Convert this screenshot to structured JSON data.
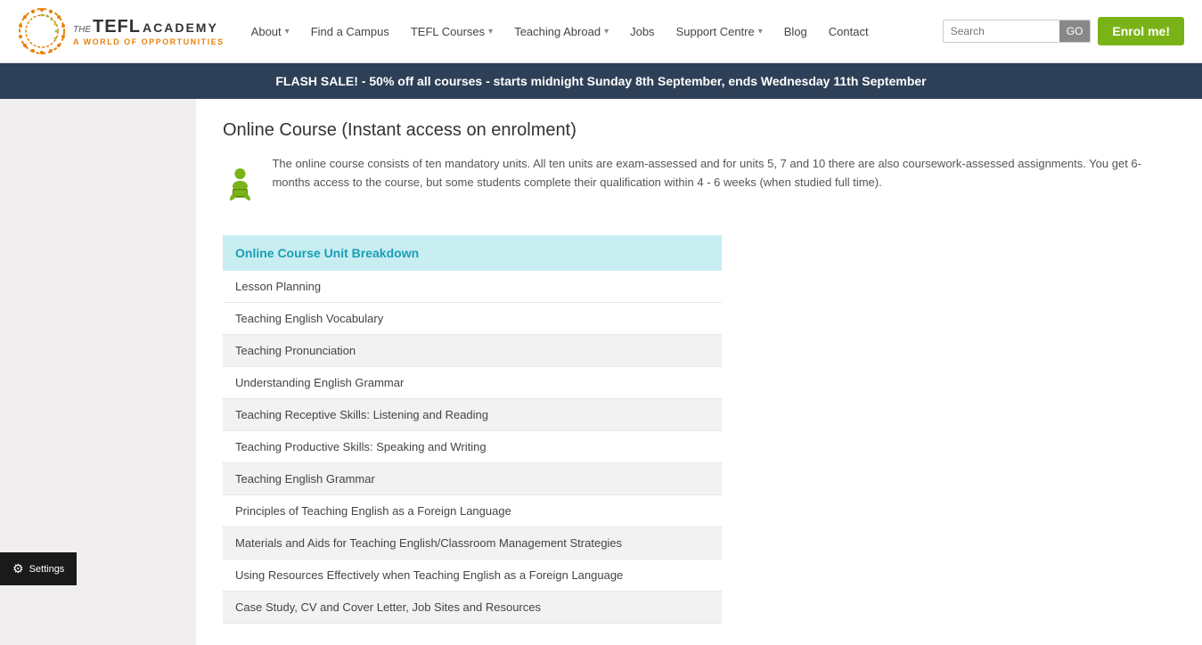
{
  "header": {
    "logo": {
      "brand_line": "THE TEFL ACADEMY",
      "tagline": "A WORLD OF OPPORTUNITIES"
    },
    "nav": [
      {
        "label": "About",
        "has_dropdown": true
      },
      {
        "label": "Find a Campus",
        "has_dropdown": false
      },
      {
        "label": "TEFL Courses",
        "has_dropdown": true
      },
      {
        "label": "Teaching Abroad",
        "has_dropdown": true
      },
      {
        "label": "Jobs",
        "has_dropdown": false
      },
      {
        "label": "Support Centre",
        "has_dropdown": true
      },
      {
        "label": "Blog",
        "has_dropdown": false
      },
      {
        "label": "Contact",
        "has_dropdown": false
      }
    ],
    "search": {
      "placeholder": "Search",
      "go_label": "GO"
    },
    "enrol_label": "Enrol me!"
  },
  "flash_banner": {
    "text": "FLASH SALE! - 50% off all courses - starts midnight Sunday 8th September, ends Wednesday 11th September"
  },
  "main": {
    "page_title": "Online Course (Instant access on enrolment)",
    "intro_text": "The online course consists of ten mandatory units. All ten units are exam-assessed and for units 5, 7 and 10 there are also coursework-assessed assignments. You get 6-months access to the course, but some students complete their qualification within 4 - 6 weeks (when studied full time).",
    "breakdown": {
      "header": "Online Course Unit Breakdown",
      "units": [
        {
          "label": "Lesson Planning",
          "shaded": false
        },
        {
          "label": "Teaching English Vocabulary",
          "shaded": false
        },
        {
          "label": "Teaching Pronunciation",
          "shaded": true
        },
        {
          "label": "Understanding English Grammar",
          "shaded": false
        },
        {
          "label": "Teaching Receptive Skills: Listening and Reading",
          "shaded": true
        },
        {
          "label": "Teaching Productive Skills: Speaking and Writing",
          "shaded": false
        },
        {
          "label": "Teaching English Grammar",
          "shaded": true
        },
        {
          "label": "Principles of Teaching English as a Foreign Language",
          "shaded": false
        },
        {
          "label": "Materials and Aids for Teaching English/Classroom Management Strategies",
          "shaded": true
        },
        {
          "label": "Using Resources Effectively when Teaching English as a Foreign Language",
          "shaded": false
        },
        {
          "label": "Case Study, CV and Cover Letter, Job Sites and Resources",
          "shaded": true
        }
      ]
    }
  },
  "settings_bar": {
    "label": "Settings"
  },
  "colors": {
    "accent_green": "#7ab317",
    "accent_orange": "#e8820c",
    "nav_dark": "#2e4057",
    "teal": "#1a9eb5",
    "teal_light": "#c8eef2"
  }
}
